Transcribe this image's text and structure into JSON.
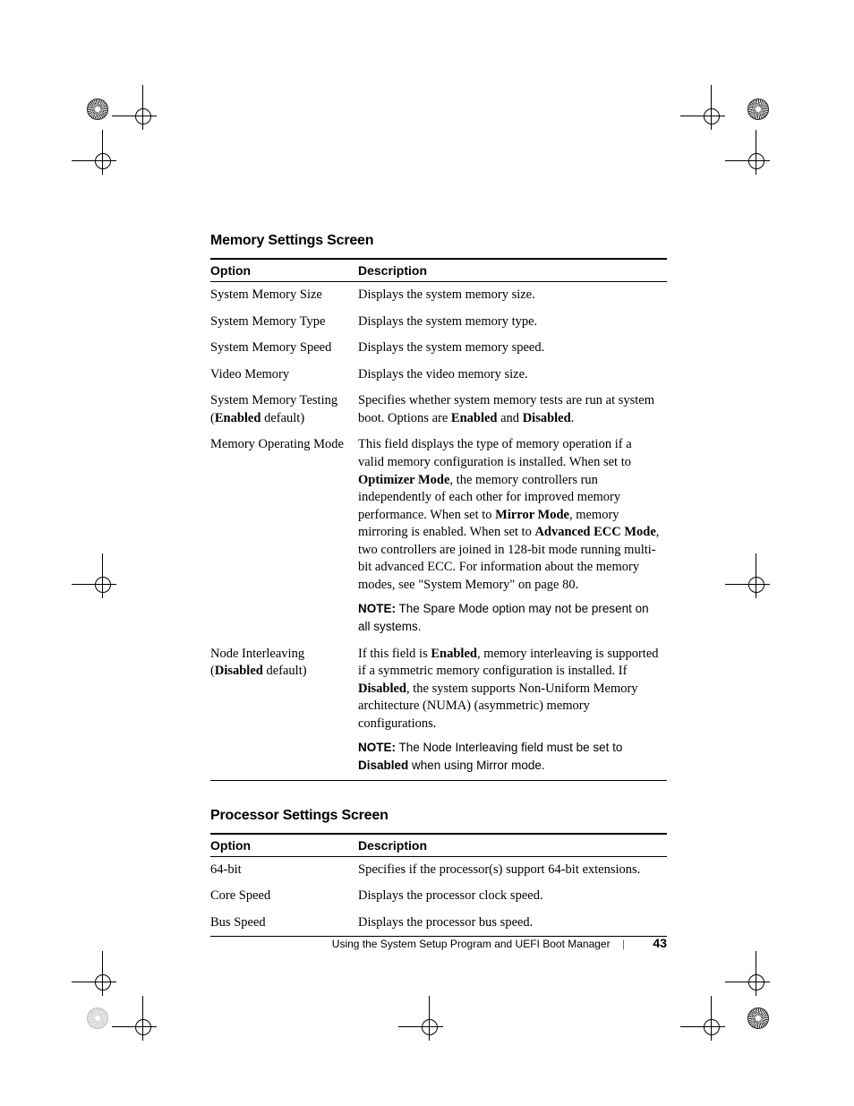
{
  "sections": [
    {
      "title": "Memory Settings Screen",
      "head_option": "Option",
      "head_desc": "Description",
      "rows": [
        {
          "opt_pre": "",
          "opt_default": "",
          "opt_bold": "",
          "opt_label": "System Memory Size",
          "desc": {
            "runs": [
              {
                "t": "Displays the system memory size."
              }
            ]
          }
        },
        {
          "opt_pre": "",
          "opt_default": "",
          "opt_bold": "",
          "opt_label": "System Memory Type",
          "desc": {
            "runs": [
              {
                "t": "Displays the system memory type."
              }
            ]
          }
        },
        {
          "opt_pre": "",
          "opt_default": "",
          "opt_bold": "",
          "opt_label": "System Memory Speed",
          "desc": {
            "runs": [
              {
                "t": "Displays the system memory speed."
              }
            ]
          }
        },
        {
          "opt_pre": "",
          "opt_default": "",
          "opt_bold": "",
          "opt_label": "Video Memory",
          "desc": {
            "runs": [
              {
                "t": "Displays the video memory size."
              }
            ]
          }
        },
        {
          "opt_pre": "System Memory Testing",
          "opt_bold": "Enabled",
          "opt_default": " default)",
          "opt_label": "",
          "desc": {
            "runs": [
              {
                "t": "Specifies whether system memory tests are run at system boot. Options are "
              },
              {
                "t": "Enabled",
                "b": true
              },
              {
                "t": " and "
              },
              {
                "t": "Disabled",
                "b": true
              },
              {
                "t": "."
              }
            ]
          }
        },
        {
          "opt_pre": "",
          "opt_default": "",
          "opt_bold": "",
          "opt_label": "Memory Operating Mode",
          "desc": {
            "runs": [
              {
                "t": "This field displays the type of memory operation if a valid memory configuration is installed. When set to "
              },
              {
                "t": "Optimizer Mode",
                "b": true
              },
              {
                "t": ", the memory controllers run independently of each other for improved memory performance. When set to "
              },
              {
                "t": "Mirror Mode",
                "b": true
              },
              {
                "t": ", memory mirroring is enabled. When set to "
              },
              {
                "t": "Advanced ECC Mode",
                "b": true
              },
              {
                "t": ", two controllers are joined in 128-bit mode running multi-bit advanced ECC. For information about the memory modes, see \"System Memory\" on page 80."
              }
            ],
            "note_label": "NOTE:",
            "note_runs": [
              {
                "t": " The Spare Mode option may not be present on all systems."
              }
            ]
          }
        },
        {
          "opt_pre": "Node Interleaving",
          "opt_bold": "Disabled",
          "opt_default": " default)",
          "opt_label": "",
          "desc": {
            "runs": [
              {
                "t": "If this field is "
              },
              {
                "t": "Enabled",
                "b": true
              },
              {
                "t": ", memory interleaving is supported if a symmetric memory configuration is installed. If "
              },
              {
                "t": "Disabled",
                "b": true
              },
              {
                "t": ", the system supports Non-Uniform Memory architecture (NUMA) (asymmetric) memory configurations."
              }
            ],
            "note_label": "NOTE:",
            "note_runs": [
              {
                "t": " The Node Interleaving field must be set to "
              },
              {
                "t": "Disabled",
                "b": true
              },
              {
                "t": " when using Mirror mode."
              }
            ]
          }
        }
      ]
    },
    {
      "title": "Processor Settings Screen",
      "head_option": "Option",
      "head_desc": "Description",
      "rows": [
        {
          "opt_pre": "",
          "opt_default": "",
          "opt_bold": "",
          "opt_label": "64-bit",
          "desc": {
            "runs": [
              {
                "t": "Specifies if the processor(s) support 64-bit extensions."
              }
            ]
          }
        },
        {
          "opt_pre": "",
          "opt_default": "",
          "opt_bold": "",
          "opt_label": "Core Speed",
          "desc": {
            "runs": [
              {
                "t": "Displays the processor clock speed."
              }
            ]
          }
        },
        {
          "opt_pre": "",
          "opt_default": "",
          "opt_bold": "",
          "opt_label": "Bus Speed",
          "desc": {
            "runs": [
              {
                "t": "Displays the processor bus speed."
              }
            ]
          }
        }
      ]
    }
  ],
  "footer": {
    "text": "Using the System Setup Program and UEFI Boot Manager",
    "page": "43"
  }
}
